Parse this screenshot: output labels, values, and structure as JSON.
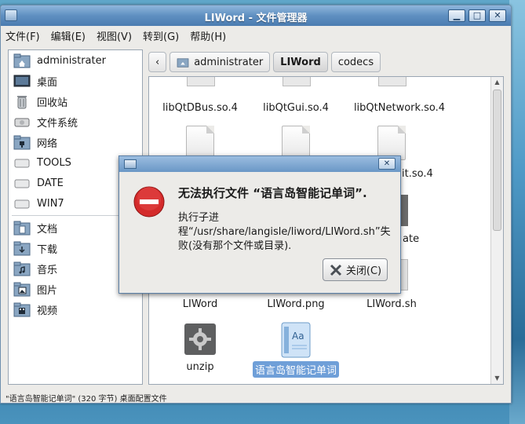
{
  "window": {
    "title": "LIWord - 文件管理器"
  },
  "menu": [
    "文件(F)",
    "编辑(E)",
    "视图(V)",
    "转到(G)",
    "帮助(H)"
  ],
  "sidebar": {
    "places": [
      {
        "label": "administrater",
        "icon": "home-folder-icon"
      },
      {
        "label": "桌面",
        "icon": "desktop-icon"
      },
      {
        "label": "回收站",
        "icon": "trash-icon"
      },
      {
        "label": "文件系统",
        "icon": "drive-icon"
      },
      {
        "label": "网络",
        "icon": "network-folder-icon"
      },
      {
        "label": "TOOLS",
        "icon": "drive-icon"
      },
      {
        "label": "DATE",
        "icon": "drive-icon"
      },
      {
        "label": "WIN7",
        "icon": "drive-icon"
      }
    ],
    "bookmarks": [
      {
        "label": "文档",
        "icon": "documents-folder-icon"
      },
      {
        "label": "下载",
        "icon": "downloads-folder-icon"
      },
      {
        "label": "音乐",
        "icon": "music-folder-icon"
      },
      {
        "label": "图片",
        "icon": "pictures-folder-icon"
      },
      {
        "label": "视频",
        "icon": "videos-folder-icon"
      }
    ]
  },
  "pathbar": {
    "back": "‹",
    "segments": [
      "administrater",
      "LIWord",
      "codecs"
    ],
    "active": "LIWord"
  },
  "files": {
    "row1": [
      "libQtDBus.so.4",
      "libQtGui.so.4",
      "libQtNetwork.so.4"
    ],
    "row2_partial": [
      "it.so.4"
    ],
    "row3_partial": [
      "ate"
    ],
    "row4": [
      "LIWord",
      "LIWord.png",
      "LIWord.sh"
    ],
    "row5": [
      "unzip",
      "语言岛智能记单词"
    ]
  },
  "status": "\"语言岛智能记单词\" (320 字节) 桌面配置文件",
  "dialog": {
    "heading": "无法执行文件 “语言岛智能记单词”.",
    "message": "执行子进程“/usr/share/langisle/liword/LIWord.sh”失败(没有那个文件或目录).",
    "close_label": "关闭(C)",
    "close_x": "✕"
  },
  "window_buttons": {
    "minimize": "▁",
    "maximize": "□",
    "close": "✕"
  }
}
